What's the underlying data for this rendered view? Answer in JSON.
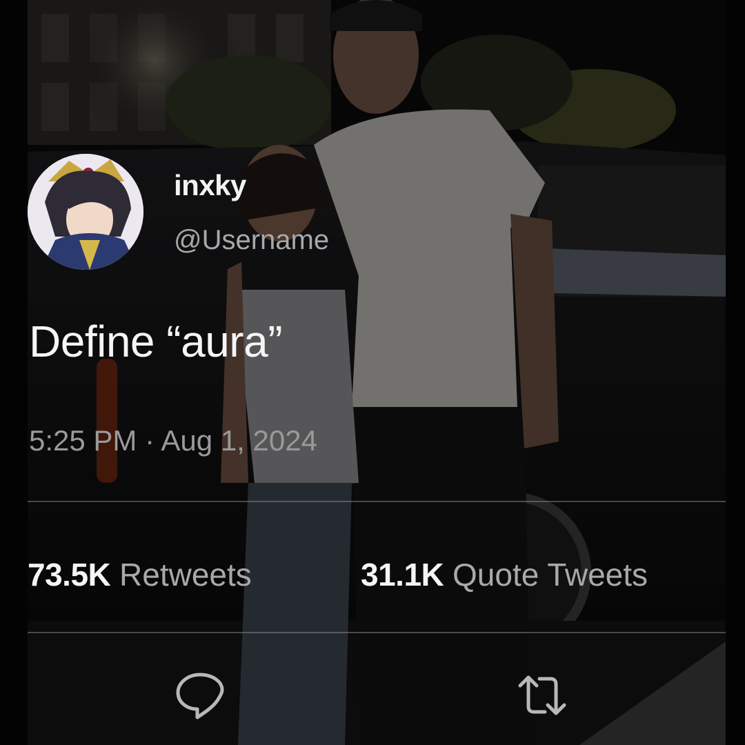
{
  "tweet": {
    "display_name": "inxky",
    "username": "@Username",
    "text": "Define “aura”",
    "timestamp": "5:25 PM · Aug 1, 2024"
  },
  "stats": {
    "retweets": {
      "count": "73.5K",
      "label": "Retweets"
    },
    "quote_tweets": {
      "count": "31.1K",
      "label": "Quote Tweets"
    }
  },
  "actions": {
    "reply_icon": "reply-icon",
    "retweet_icon": "retweet-icon"
  },
  "colors": {
    "text_primary": "#f5f5f5",
    "text_secondary": "#9a9a9a",
    "divider": "#5a5a5a"
  }
}
